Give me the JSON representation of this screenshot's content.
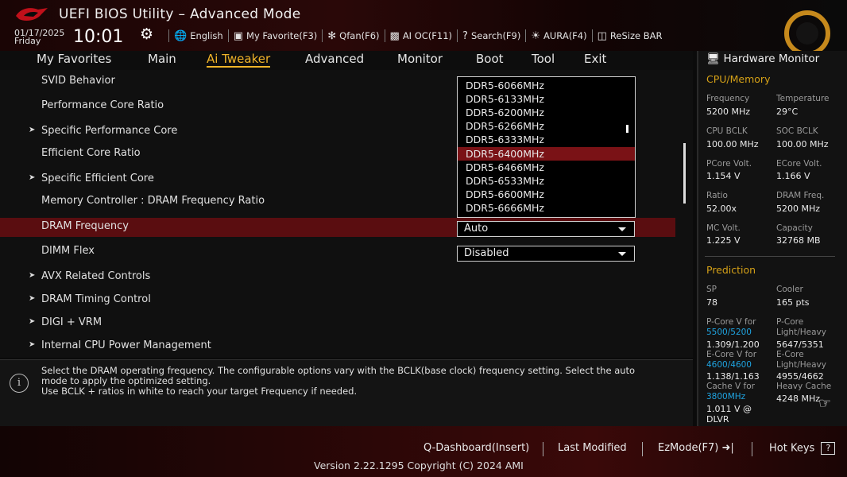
{
  "header": {
    "title": "UEFI BIOS Utility – Advanced Mode",
    "date": "01/17/2025",
    "day": "Friday",
    "time": "10:01",
    "toolbar": [
      {
        "icon": "globe-icon",
        "label": "English"
      },
      {
        "icon": "favorite-icon",
        "label": "My Favorite(F3)"
      },
      {
        "icon": "fan-icon",
        "label": "Qfan(F6)"
      },
      {
        "icon": "ai-chip-icon",
        "label": "AI OC(F11)"
      },
      {
        "icon": "search-icon",
        "label": "Search(F9)"
      },
      {
        "icon": "aura-light-icon",
        "label": "AURA(F4)"
      },
      {
        "icon": "resize-bar-icon",
        "label": "ReSize BAR"
      }
    ]
  },
  "nav": {
    "tabs": [
      "My Favorites",
      "Main",
      "Ai Tweaker",
      "Advanced",
      "Monitor",
      "Boot",
      "Tool",
      "Exit"
    ],
    "active": "Ai Tweaker"
  },
  "settings": {
    "rows": [
      {
        "label": "SVID Behavior",
        "submenu": false
      },
      {
        "label": "Performance Core Ratio",
        "submenu": false
      },
      {
        "label": "Specific Performance Core",
        "submenu": true
      },
      {
        "label": "Efficient Core Ratio",
        "submenu": false
      },
      {
        "label": "Specific Efficient Core",
        "submenu": true
      },
      {
        "label": "Memory Controller : DRAM Frequency Ratio",
        "submenu": false
      },
      {
        "label": "DRAM Frequency",
        "submenu": false,
        "value": "Auto"
      },
      {
        "label": "DIMM Flex",
        "submenu": false,
        "value": "Disabled"
      },
      {
        "label": "AVX Related Controls",
        "submenu": true
      },
      {
        "label": "DRAM Timing Control",
        "submenu": true
      },
      {
        "label": "DIGI + VRM",
        "submenu": true
      },
      {
        "label": "Internal CPU Power Management",
        "submenu": true
      }
    ],
    "selected_row": "DRAM Frequency"
  },
  "dropdown": {
    "options": [
      "DDR5-6066MHz",
      "DDR5-6133MHz",
      "DDR5-6200MHz",
      "DDR5-6266MHz",
      "DDR5-6333MHz",
      "DDR5-6400MHz",
      "DDR5-6466MHz",
      "DDR5-6533MHz",
      "DDR5-6600MHz",
      "DDR5-6666MHz"
    ],
    "highlighted": "DDR5-6400MHz"
  },
  "help": {
    "line1": "Select the DRAM operating frequency. The configurable options vary with the BCLK(base clock) frequency setting. Select the auto",
    "line2": "mode to apply the optimized setting.",
    "line3": "Use BCLK + ratios in white to reach your target Frequency if needed."
  },
  "hardware_monitor": {
    "title": "Hardware Monitor",
    "cpu_section": "CPU/Memory",
    "cpu": [
      {
        "label": "Frequency",
        "value": "5200 MHz"
      },
      {
        "label": "Temperature",
        "value": "29°C"
      },
      {
        "label": "CPU BCLK",
        "value": "100.00 MHz"
      },
      {
        "label": "SOC BCLK",
        "value": "100.00 MHz"
      },
      {
        "label": "PCore Volt.",
        "value": "1.154 V"
      },
      {
        "label": "ECore Volt.",
        "value": "1.166 V"
      },
      {
        "label": "Ratio",
        "value": "52.00x"
      },
      {
        "label": "DRAM Freq.",
        "value": "5200 MHz"
      },
      {
        "label": "MC Volt.",
        "value": "1.225 V"
      },
      {
        "label": "Capacity",
        "value": "32768 MB"
      }
    ],
    "prediction_section": "Prediction",
    "sp_label": "SP",
    "sp_value": "78",
    "cooler_label": "Cooler",
    "cooler_value": "165 pts",
    "pcore_v_label": "P-Core V for",
    "pcore_v_freq": "5500/5200",
    "pcore_v_value": "1.309/1.200",
    "pcore_lh_label1": "P-Core",
    "pcore_lh_label2": "Light/Heavy",
    "pcore_lh_value": "5647/5351",
    "ecore_v_label": "E-Core V for",
    "ecore_v_freq": "4600/4600",
    "ecore_v_value": "1.138/1.163",
    "ecore_lh_label1": "E-Core",
    "ecore_lh_label2": "Light/Heavy",
    "ecore_lh_value": "4955/4662",
    "cache_v_label": "Cache V for",
    "cache_v_freq": "3800MHz",
    "cache_v_value1": "1.011 V @",
    "cache_v_value2": "DLVR",
    "heavy_cache_label": "Heavy Cache",
    "heavy_cache_value": "4248 MHz"
  },
  "footer": {
    "qdashboard": "Q-Dashboard(Insert)",
    "last_modified": "Last Modified",
    "ezmode": "EzMode(F7)",
    "hotkeys": "Hot Keys",
    "hotkeys_key": "?",
    "version": "Version 2.22.1295 Copyright (C) 2024 AMI"
  },
  "colors": {
    "accent": "#f0b429",
    "selection": "#5a0d10",
    "highlight": "#7a1216",
    "prediction_blue": "#1fa3e0"
  }
}
